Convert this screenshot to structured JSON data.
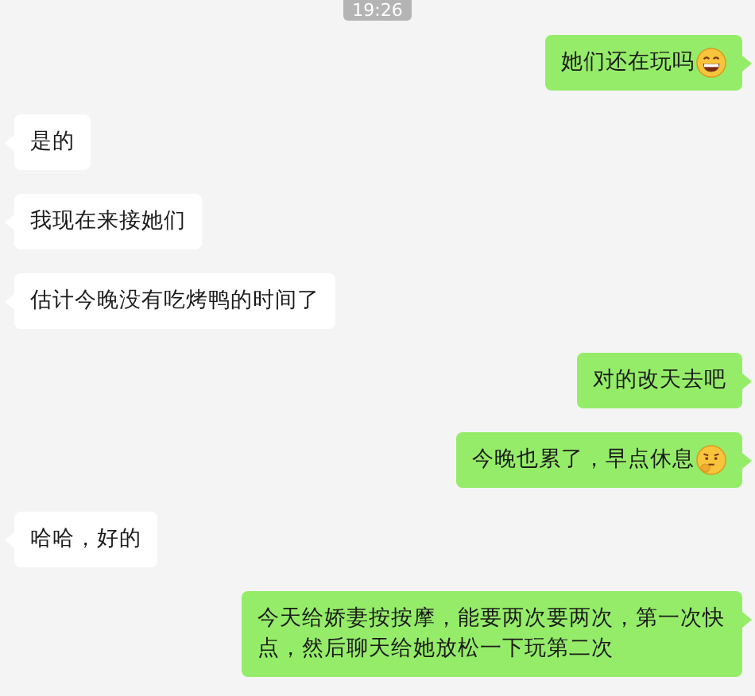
{
  "timestamp": "19:26",
  "messages": [
    {
      "outgoing": true,
      "text": "她们还在玩吗",
      "emoji": {
        "kind": "grinning"
      }
    },
    {
      "outgoing": false,
      "text": "是的"
    },
    {
      "outgoing": false,
      "text": "我现在来接她们"
    },
    {
      "outgoing": false,
      "text": "估计今晚没有吃烤鸭的时间了"
    },
    {
      "outgoing": true,
      "text": "对的改天去吧"
    },
    {
      "outgoing": true,
      "text": "今晚也累了，早点休息",
      "emoji": {
        "kind": "thinking"
      }
    },
    {
      "outgoing": false,
      "text": "哈哈，好的"
    },
    {
      "outgoing": true,
      "text": "今天给娇妻按按摩，能要两次要两次，第一次快点，然后聊天给她放松一下玩第二次"
    }
  ]
}
